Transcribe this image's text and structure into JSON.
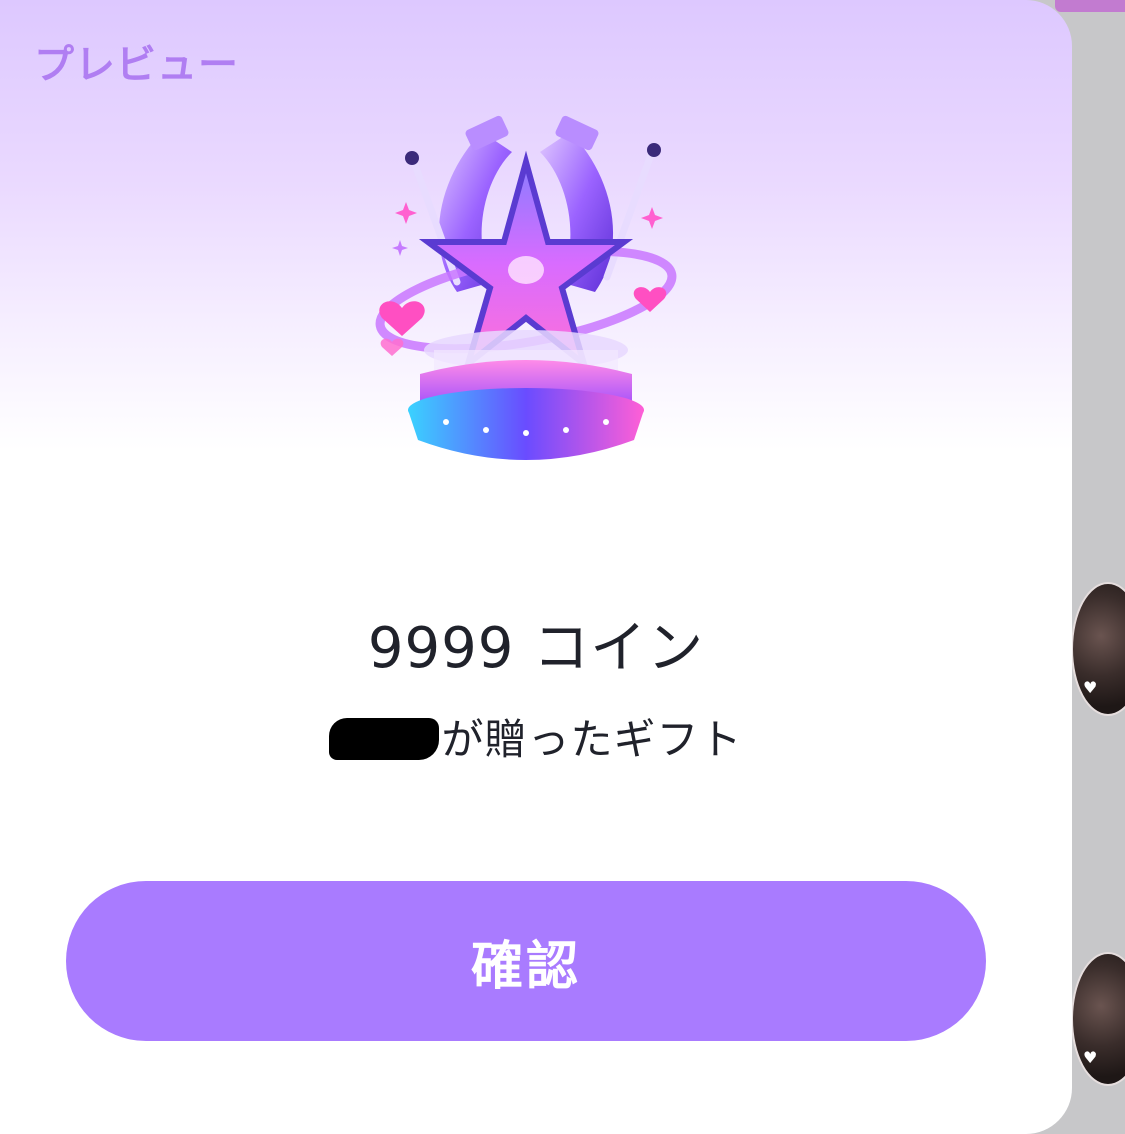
{
  "dialog": {
    "title": "プレビュー",
    "gift": {
      "image_icon": "star-trophy-gift-icon",
      "coins_value": "9999",
      "coins_unit": "コイン",
      "sender_suffix": "が贈ったギフト"
    },
    "confirm_label": "確認"
  },
  "colors": {
    "accent": "#a97bff",
    "title": "#b07ef2",
    "text": "#20222b"
  }
}
